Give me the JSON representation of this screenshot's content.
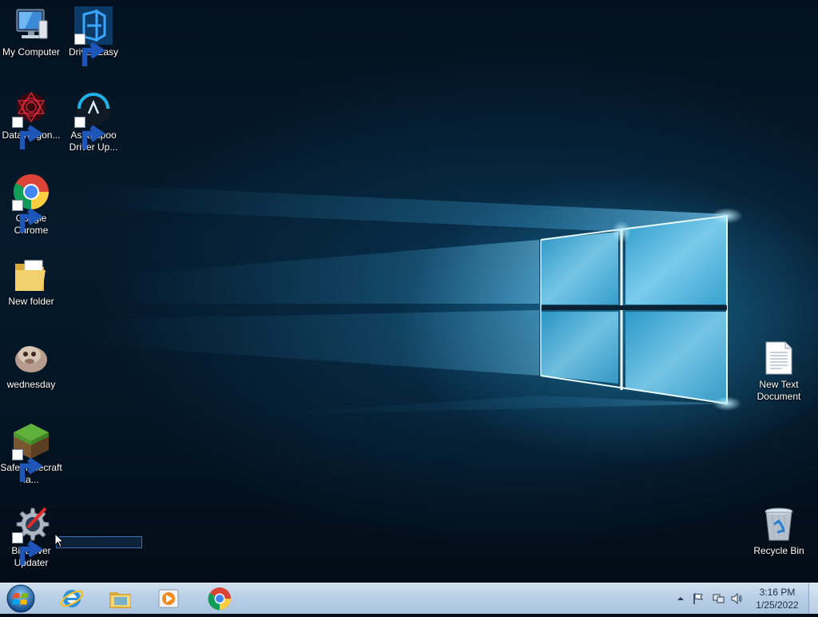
{
  "desktop": {
    "icons": [
      {
        "label": "My Computer",
        "icon": "computer-icon",
        "shortcut": false
      },
      {
        "label": "Driver Easy",
        "icon": "driver-easy-icon",
        "shortcut": true
      },
      {
        "label": "DataWagon...",
        "icon": "datawagon-icon",
        "shortcut": true
      },
      {
        "label": "Ashampoo Driver Up...",
        "icon": "ashampoo-icon",
        "shortcut": true
      },
      {
        "label": "Google Chrome",
        "icon": "chrome-icon",
        "shortcut": true
      },
      {
        "label": "New folder",
        "icon": "folder-icon",
        "shortcut": false
      },
      {
        "label": "wednesday",
        "icon": "image-file-icon",
        "shortcut": false
      },
      {
        "label": "Safe minecraft la...",
        "icon": "minecraft-icon",
        "shortcut": true
      },
      {
        "label": "Bit Driver Updater",
        "icon": "bit-driver-updater-icon",
        "shortcut": true
      },
      {
        "label": "New Text Document",
        "icon": "text-document-icon",
        "shortcut": false
      },
      {
        "label": "Recycle Bin",
        "icon": "recycle-bin-icon",
        "shortcut": false
      }
    ]
  },
  "taskbar": {
    "pinned": [
      {
        "name": "internet-explorer-icon"
      },
      {
        "name": "file-explorer-icon"
      },
      {
        "name": "media-player-icon"
      },
      {
        "name": "chrome-icon"
      }
    ],
    "tray_icons": [
      "show-hidden-icons-icon",
      "action-center-flag-icon",
      "network-icon",
      "volume-icon"
    ],
    "clock": {
      "time": "3:16 PM",
      "date": "1/25/2022"
    }
  }
}
